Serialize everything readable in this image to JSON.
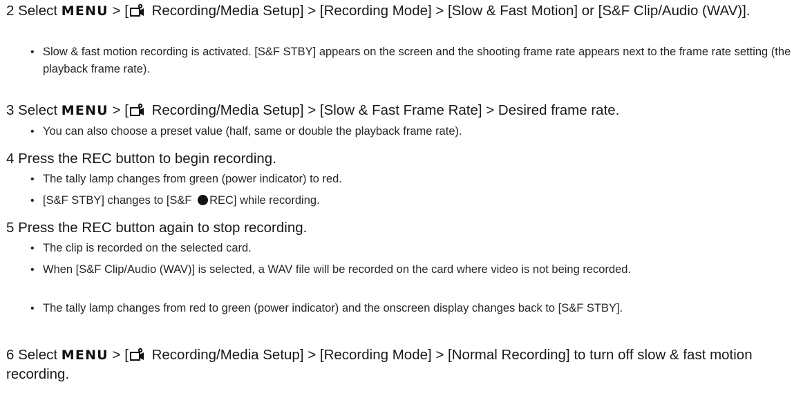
{
  "steps": [
    {
      "number": "2",
      "verb": "Select",
      "menu": "MENU",
      "pre": " > [",
      "text": " Recording/Media Setup] > [Recording Mode] > [Slow & Fast Motion] or [S&F Clip/Audio (WAV)].",
      "icon": "camera-setup-icon",
      "bullets": [
        "Slow & fast motion recording is activated. [S&F STBY] appears on the screen and the shooting frame rate appears next to the frame rate setting (the playback frame rate)."
      ]
    },
    {
      "number": "3",
      "verb": "Select",
      "menu": "MENU",
      "pre": " > [",
      "text": " Recording/Media Setup] > [Slow & Fast Frame Rate] > Desired frame rate.",
      "icon": "camera-setup-icon",
      "bullets": [
        "You can also choose a preset value (half, same or double the playback frame rate)."
      ]
    },
    {
      "number": "4",
      "text": "Press the REC button to begin recording.",
      "bullets": [
        "The tally lamp changes from green (power indicator) to red."
      ],
      "bullet_rec_pre": "[S&F STBY] changes to [S&F ",
      "bullet_rec_post": "REC] while recording."
    },
    {
      "number": "5",
      "text": "Press the REC button again to stop recording.",
      "bullets": [
        "The clip is recorded on the selected card.",
        "When [S&F Clip/Audio (WAV)] is selected, a WAV file will be recorded on the card where video is not being recorded.",
        "The tally lamp changes from red to green (power indicator) and the onscreen display changes back to [S&F STBY]."
      ]
    },
    {
      "number": "6",
      "verb": "Select",
      "menu": "MENU",
      "pre": " > [",
      "text": " Recording/Media Setup] > [Recording Mode] > [Normal Recording] to turn off slow & fast motion recording.",
      "icon": "camera-setup-icon"
    }
  ]
}
